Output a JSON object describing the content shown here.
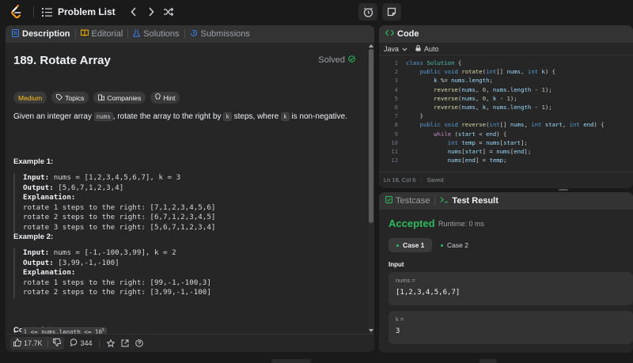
{
  "topbar": {
    "problem_list_label": "Problem List"
  },
  "tabs": {
    "description": "Description",
    "editorial": "Editorial",
    "solutions": "Solutions",
    "submissions": "Submissions"
  },
  "problem": {
    "title": "189. Rotate Array",
    "solved_label": "Solved",
    "difficulty": "Medium",
    "chips": [
      "Topics",
      "Companies",
      "Hint"
    ],
    "statement_pre": "Given an integer array ",
    "statement_code1": "nums",
    "statement_mid": ", rotate the array to the right by ",
    "statement_code2": "k",
    "statement_mid2": " steps, where ",
    "statement_code3": "k",
    "statement_post": " is non-negative.",
    "example1_title": "Example 1:",
    "example1": {
      "input_label": "Input:",
      "input": " nums = [1,2,3,4,5,6,7], k = 3",
      "output_label": "Output:",
      "output": " [5,6,7,1,2,3,4]",
      "explanation_label": "Explanation:",
      "lines": [
        "rotate 1 steps to the right: [7,1,2,3,4,5,6]",
        "rotate 2 steps to the right: [6,7,1,2,3,4,5]",
        "rotate 3 steps to the right: [5,6,7,1,2,3,4]"
      ]
    },
    "example2_title": "Example 2:",
    "example2": {
      "input_label": "Input:",
      "input": " nums = [-1,-100,3,99], k = 2",
      "output_label": "Output:",
      "output": " [3,99,-1,-100]",
      "explanation_label": "Explanation:",
      "lines": [
        "rotate 1 steps to the right: [99,-1,-100,3]",
        "rotate 2 steps to the right: [3,99,-1,-100]"
      ]
    },
    "constraints_title": "Constraints:",
    "constraint1": "1 <= nums.length <= 10",
    "constraint1_exp": "5"
  },
  "footer": {
    "likes": "17.7K",
    "comments": "344"
  },
  "code_panel": {
    "title": "Code",
    "language": "Java",
    "auto": "Auto",
    "status_pos": "Ln 16, Col 6",
    "status_saved": "Saved",
    "line_numbers": [
      "1",
      "2",
      "3",
      "4",
      "5",
      "6",
      "7",
      "8",
      "9",
      "10",
      "11",
      "12"
    ]
  },
  "result_panel": {
    "testcase_tab": "Testcase",
    "result_tab": "Test Result",
    "verdict": "Accepted",
    "runtime": "Runtime: 0 ms",
    "case1": "Case 1",
    "case2": "Case 2",
    "input_label": "Input",
    "param1_name": "nums =",
    "param1_value": "[1,2,3,4,5,6,7]",
    "param2_name": "k =",
    "param2_value": "3"
  },
  "colors": {
    "accepted": "#2cbb5d",
    "medium": "#ffc01e",
    "background": "#1a1a1a",
    "panel": "#262626"
  }
}
